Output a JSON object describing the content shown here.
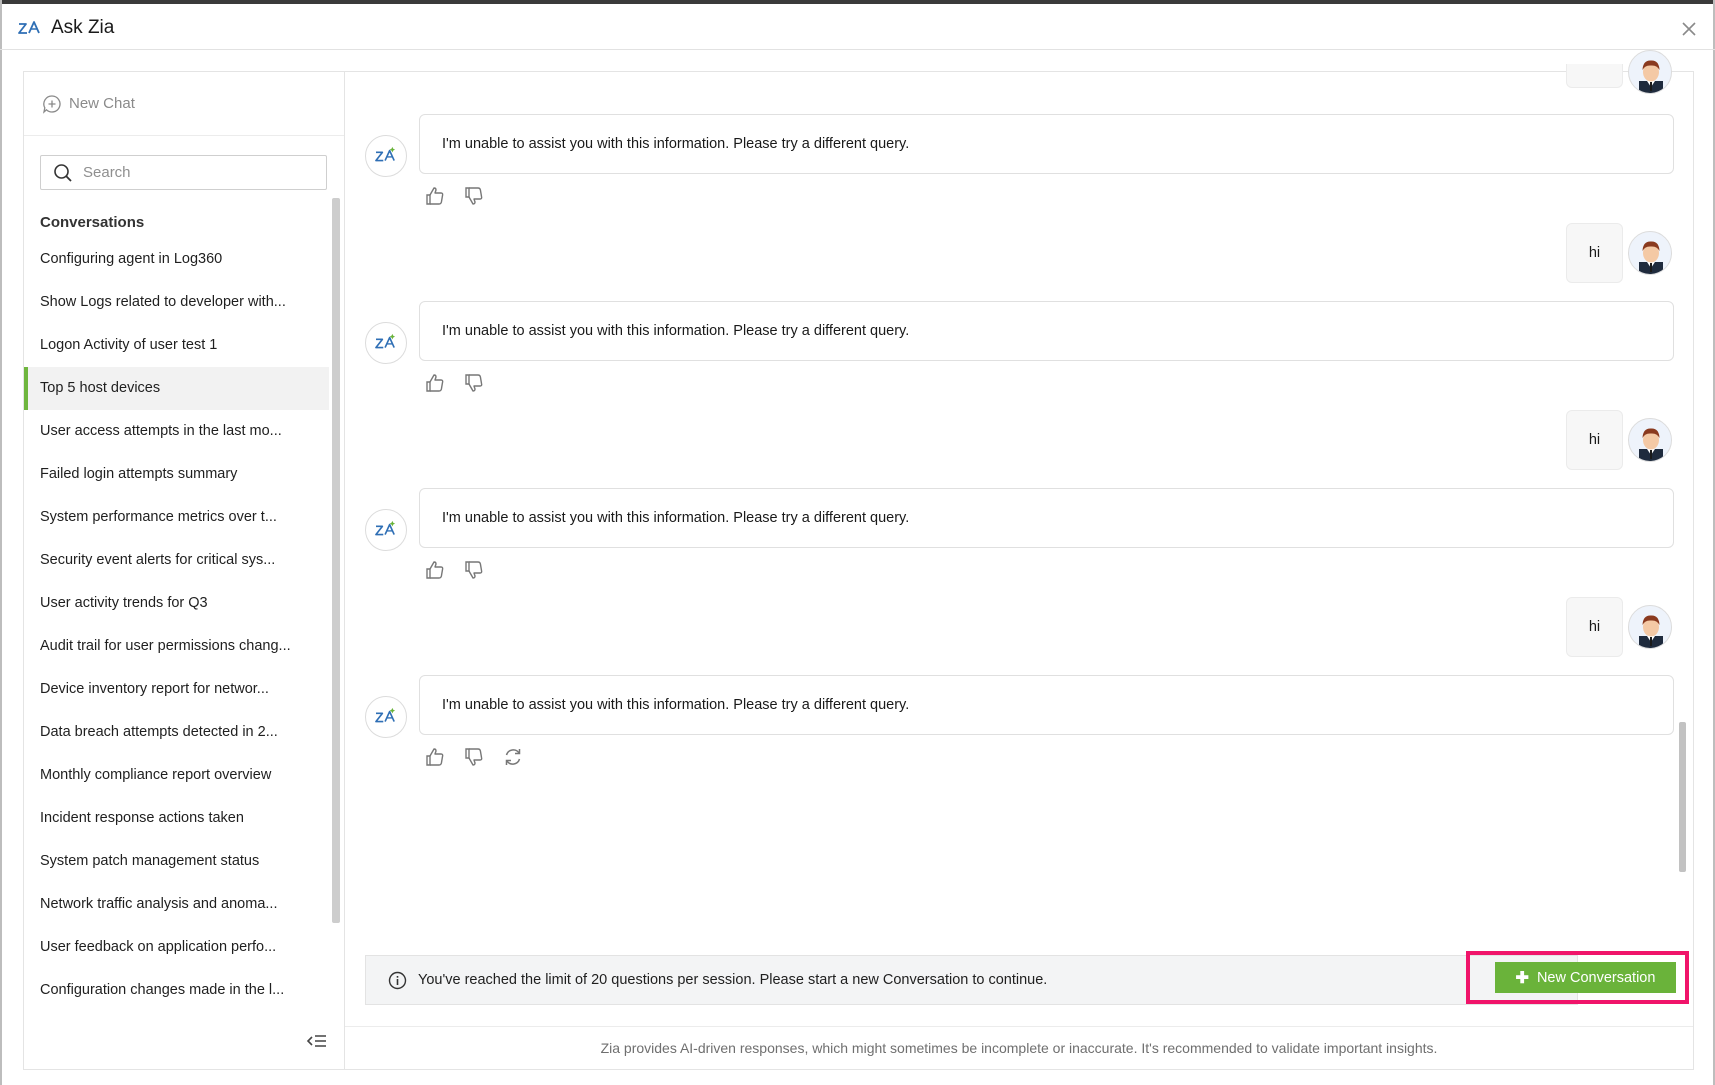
{
  "window": {
    "title": "Ask Zia"
  },
  "sidebar": {
    "new_chat_label": "New Chat",
    "search_placeholder": "Search",
    "conversations_heading": "Conversations",
    "conversations": [
      {
        "label": "Configuring agent in Log360",
        "active": false
      },
      {
        "label": "Show Logs related to developer with...",
        "active": false
      },
      {
        "label": "Logon Activity of user test 1",
        "active": false
      },
      {
        "label": "Top 5 host devices",
        "active": true
      },
      {
        "label": "User access attempts in the last mo...",
        "active": false
      },
      {
        "label": "Failed login attempts summary",
        "active": false
      },
      {
        "label": "System performance metrics over t...",
        "active": false
      },
      {
        "label": "Security event alerts for critical sys...",
        "active": false
      },
      {
        "label": "User activity trends for Q3",
        "active": false
      },
      {
        "label": "Audit trail for user permissions chang...",
        "active": false
      },
      {
        "label": "Device inventory report for networ...",
        "active": false
      },
      {
        "label": "Data breach attempts detected in 2...",
        "active": false
      },
      {
        "label": "Monthly compliance report overview",
        "active": false
      },
      {
        "label": "Incident response actions taken",
        "active": false
      },
      {
        "label": "System patch management status",
        "active": false
      },
      {
        "label": "Network traffic analysis and anoma...",
        "active": false
      },
      {
        "label": "User feedback on application perfo...",
        "active": false
      },
      {
        "label": "Configuration changes made in the l...",
        "active": false
      }
    ]
  },
  "chat": {
    "bot_messages": [
      "I'm unable to assist you with this information. Please try a different query.",
      "I'm unable to assist you with this information. Please try a different query.",
      "I'm unable to assist you with this information. Please try a different query.",
      "I'm unable to assist you with this information. Please try a different query."
    ],
    "user_messages": [
      "hi",
      "hi",
      "hi"
    ]
  },
  "limit_notice": {
    "text": "You've reached the limit of 20 questions per session. Please start a new Conversation to continue.",
    "button_label": "New Conversation"
  },
  "footer": {
    "disclaimer": "Zia provides AI-driven responses, which might sometimes be incomplete or inaccurate. It's recommended to validate important insights."
  },
  "colors": {
    "accent_green": "#6ab33a",
    "highlight_pink": "#f0146a",
    "active_marker": "#6fb63e"
  },
  "icons": {
    "logo": "zia-logo-icon",
    "close": "close-icon",
    "new_chat": "chat-plus-icon",
    "search": "search-icon",
    "like": "thumbs-up-icon",
    "dislike": "thumbs-down-icon",
    "regenerate": "refresh-icon",
    "info": "info-icon",
    "collapse": "collapse-sidebar-icon"
  }
}
